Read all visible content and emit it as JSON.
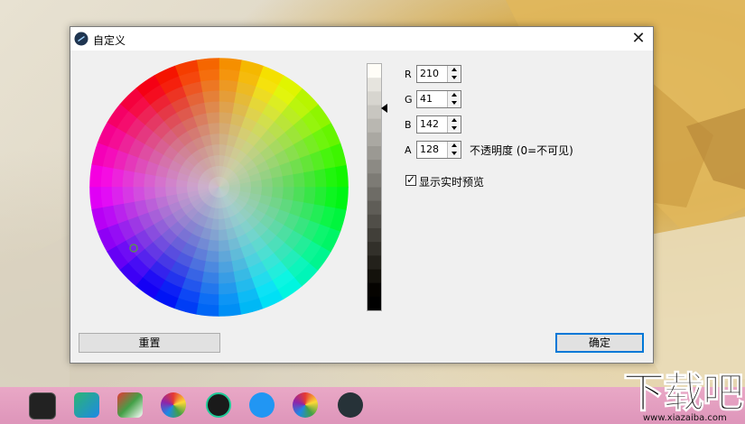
{
  "dialog": {
    "title": "自定义",
    "close_glyph": "✕",
    "wheel_marker_color": "#b06a9a"
  },
  "channels": [
    {
      "label": "R",
      "value": "210"
    },
    {
      "label": "G",
      "value": "41"
    },
    {
      "label": "B",
      "value": "142"
    },
    {
      "label": "A",
      "value": "128"
    }
  ],
  "opacity_label": "不透明度 (0=不可见)",
  "live_preview": {
    "label": "显示实时预览",
    "checked": true
  },
  "buttons": {
    "reset": "重置",
    "ok": "确定"
  },
  "watermark": {
    "text": "下载吧",
    "url": "www.xiazaiba.com"
  },
  "taskbar_icons": [
    "app-icon-1",
    "app-icon-2",
    "app-icon-3",
    "app-icon-4",
    "app-icon-5",
    "app-icon-6",
    "app-icon-7",
    "app-icon-8"
  ],
  "accent_color": "#0078d7"
}
